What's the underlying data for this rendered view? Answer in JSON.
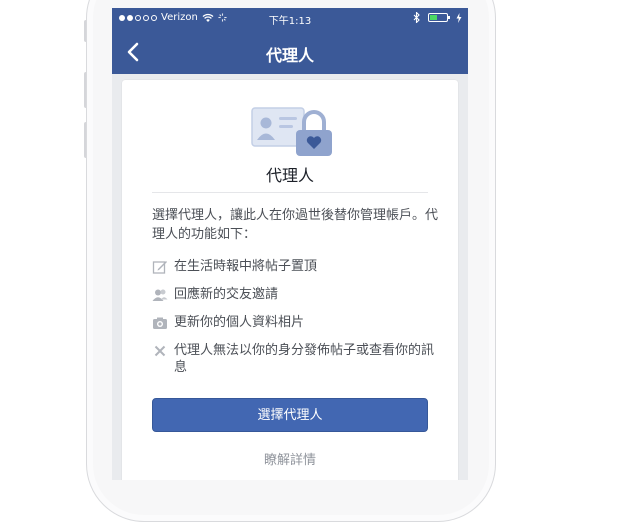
{
  "status_bar": {
    "carrier": "Verizon",
    "time": "下午1:13",
    "signal_bars_filled": 2,
    "signal_bars_total": 5,
    "battery_level": 0.45
  },
  "nav": {
    "title": "代理人"
  },
  "card": {
    "title": "代理人",
    "intro": "選擇代理人，讓此人在你過世後替你管理帳戶。代理人的功能如下：",
    "features": [
      {
        "icon": "edit-icon",
        "text": "在生活時報中將帖子置頂"
      },
      {
        "icon": "friends-icon",
        "text": "回應新的交友邀請"
      },
      {
        "icon": "camera-icon",
        "text": "更新你的個人資料相片"
      },
      {
        "icon": "close-icon",
        "text": "代理人無法以你的身分發佈帖子或查看你的訊息"
      }
    ],
    "primary_button": "選擇代理人",
    "learn_more": "瞭解詳情"
  },
  "colors": {
    "brand": "#3b5998",
    "button": "#4267b2",
    "battery": "#4cd964"
  }
}
